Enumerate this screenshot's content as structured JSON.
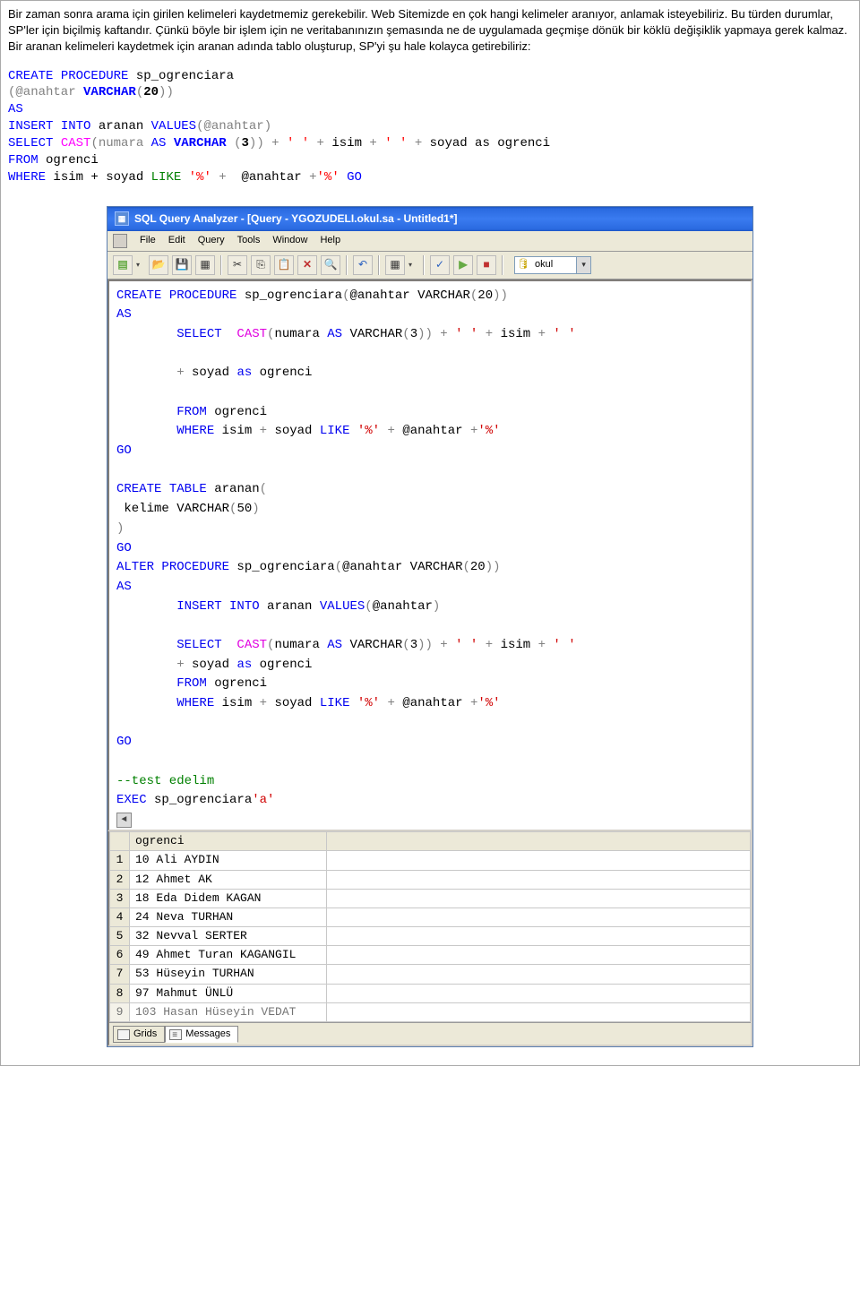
{
  "intro": {
    "p1": "Bir zaman sonra arama için girilen kelimeleri kaydetmemiz gerekebilir. Web Sitemizde en çok hangi kelimeler aranıyor, anlamak isteyebiliriz. Bu türden durumlar, SP'ler için biçilmiş kaftandır. Çünkü böyle bir işlem için ne veritabanınızın şemasında ne de uygulamada geçmişe dönük bir köklü değişiklik yapmaya gerek kalmaz. Bir aranan kelimeleri kaydetmek için aranan adında tablo oluşturup, SP'yi şu hale kolayca getirebiliriz:"
  },
  "code": {
    "CREATE": "CREATE",
    "PROCEDURE": "PROCEDURE",
    "sp_name": " sp_ogrenciara",
    "param_open": "(@anahtar ",
    "VARCHAR": "VARCHAR",
    "paren20": "(",
    "twenty": "20",
    "paren20c": ")",
    "param_close": ")",
    "AS": "AS",
    "INSERT": "INSERT",
    "INTO": "INTO",
    "aranan": " aranan ",
    "VALUES": "VALUES",
    "values_arg": "(@anahtar)",
    "SELECT": "SELECT",
    "CAST": "CAST",
    "cast_open": "(numara ",
    "AS2": "AS",
    "paren3": " (",
    "three": "3",
    "paren3c": ")",
    "cast_close": ")",
    "plus": " + ",
    "q": "' '",
    "isim": "isim",
    "soyad": "soyad",
    "as": " as ",
    "ogrenci": "ogrenci",
    "FROM": "FROM",
    "from_t": " ogrenci",
    "WHERE": "WHERE",
    "where_lhs": " isim + soyad ",
    "LIKE": "LIKE",
    "pct": "'%'",
    "anahtar": " @anahtar ",
    "plus2": "+",
    "GO": "GO"
  },
  "window": {
    "title": "SQL Query Analyzer - [Query - YGOZUDELI.okul.sa - Untitled1*]",
    "menu": {
      "file": "File",
      "edit": "Edit",
      "query": "Query",
      "tools": "Tools",
      "window": "Window",
      "help": "Help"
    },
    "db": "okul"
  },
  "editor": {
    "l1a": "CREATE",
    "l1b": " PROCEDURE",
    "l1c": " sp_ogrenciara",
    "l1d": "(",
    "l1e": "@anahtar VARCHAR",
    "l1f": "(",
    "l1g": "20",
    "l1h": "))",
    "l2": "AS",
    "l3a": "        SELECT  ",
    "l3b": "CAST",
    "l3c": "(",
    "l3d": "numara ",
    "l3e": "AS",
    "l3f": " VARCHAR",
    "l3g": "(",
    "l3h": "3",
    "l3i": "))",
    "l3j": " + ",
    "l3k": "' '",
    "l3l": " + ",
    "l3m": "isim ",
    "l3n": "+ ",
    "l3o": "' '",
    "l4a": "        + ",
    "l4b": "soyad ",
    "l4c": "as",
    "l4d": " ogrenci",
    "l5a": "        FROM",
    "l5b": " ogrenci",
    "l6a": "        WHERE",
    "l6b": " isim ",
    "l6c": "+",
    "l6d": " soyad ",
    "l6e": "LIKE ",
    "l6f": "'%'",
    "l6g": " + ",
    "l6h": "@anahtar ",
    "l6i": "+",
    "l6j": "'%'",
    "l7": "GO",
    "l9a": "CREATE",
    "l9b": " TABLE",
    "l9c": " aranan",
    "l9d": "(",
    "l10a": " kelime VARCHAR",
    "l10b": "(",
    "l10c": "50",
    "l10d": ")",
    "l11": ")",
    "l12": "GO",
    "l13a": "ALTER",
    "l13b": " PROCEDURE",
    "l13c": " sp_ogrenciara",
    "l13d": "(",
    "l13e": "@anahtar VARCHAR",
    "l13f": "(",
    "l13g": "20",
    "l13h": "))",
    "l14": "AS",
    "l15a": "        INSERT",
    "l15b": " INTO",
    "l15c": " aranan ",
    "l15d": "VALUES",
    "l15e": "(",
    "l15f": "@anahtar",
    "l15g": ")",
    "l17a": "        SELECT  ",
    "l17b": "CAST",
    "l17c": "(",
    "l17d": "numara ",
    "l17e": "AS",
    "l17f": " VARCHAR",
    "l17g": "(",
    "l17h": "3",
    "l17i": "))",
    "l17j": " + ",
    "l17k": "' '",
    "l17l": " + ",
    "l17m": "isim ",
    "l17n": "+ ",
    "l17o": "' '",
    "l18a": "        + ",
    "l18b": "soyad ",
    "l18c": "as",
    "l18d": " ogrenci",
    "l19a": "        FROM",
    "l19b": " ogrenci",
    "l20a": "        WHERE",
    "l20b": " isim ",
    "l20c": "+",
    "l20d": " soyad ",
    "l20e": "LIKE ",
    "l20f": "'%'",
    "l20g": " + ",
    "l20h": "@anahtar ",
    "l20i": "+",
    "l20j": "'%'",
    "l22": "GO",
    "l24": "--test edelim",
    "l25a": "EXEC",
    "l25b": " sp_ogrenciara",
    "l25c": "'a'"
  },
  "results": {
    "header": "ogrenci",
    "rows": [
      {
        "n": "1",
        "v": "10 Ali AYDIN"
      },
      {
        "n": "2",
        "v": "12 Ahmet AK"
      },
      {
        "n": "3",
        "v": "18 Eda Didem KAGAN"
      },
      {
        "n": "4",
        "v": "24 Neva TURHAN"
      },
      {
        "n": "5",
        "v": "32 Nevval SERTER"
      },
      {
        "n": "6",
        "v": "49 Ahmet Turan KAGANGIL"
      },
      {
        "n": "7",
        "v": "53 Hüseyin TURHAN"
      },
      {
        "n": "8",
        "v": "97 Mahmut ÜNLÜ"
      },
      {
        "n": "9",
        "v": "103 Hasan Hüseyin VEDAT"
      }
    ],
    "tab_grids": "Grids",
    "tab_messages": "Messages"
  }
}
